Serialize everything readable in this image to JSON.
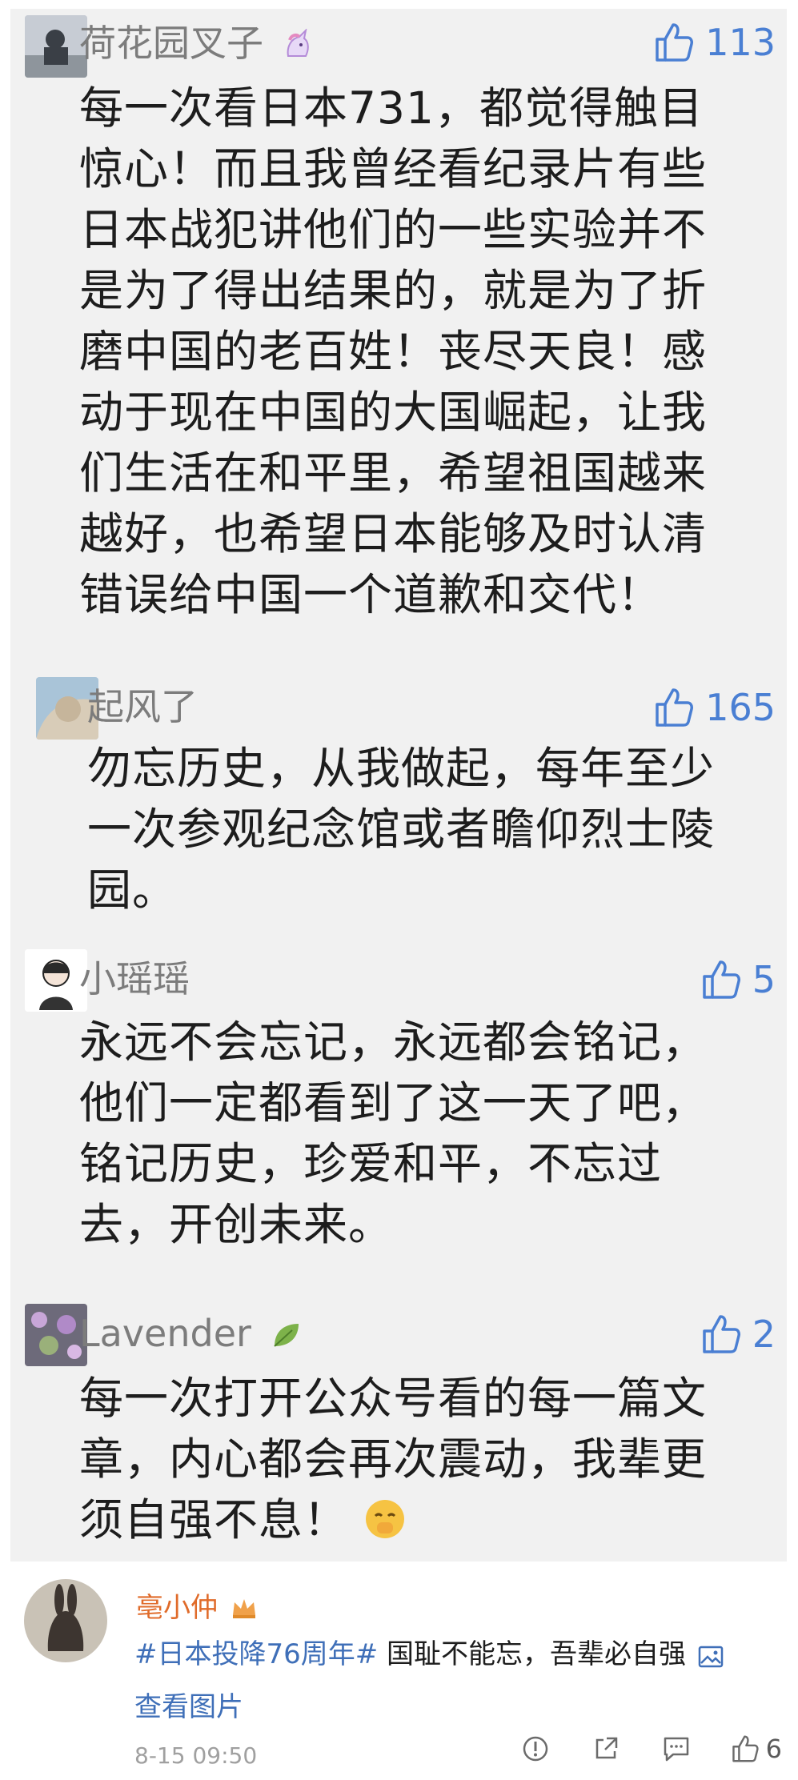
{
  "comments": [
    {
      "name": "荷花园叉子",
      "likes": "113",
      "lines": [
        "每一次看日本731，都觉得触目",
        "惊心！而且我曾经看纪录片有些",
        "日本战犯讲他们的一些实验并不",
        "是为了得出结果的，就是为了折",
        "磨中国的老百姓！丧尽天良！感",
        "动于现在中国的大国崛起，让我",
        "们生活在和平里，希望祖国越来",
        "越好，也希望日本能够及时认清",
        "错误给中国一个道歉和交代！"
      ]
    },
    {
      "name": "起风了",
      "likes": "165",
      "lines": [
        "勿忘历史，从我做起，每年至少",
        "一次参观纪念馆或者瞻仰烈士陵",
        "园。"
      ]
    },
    {
      "name": "小瑶瑶",
      "likes": "5",
      "lines": [
        "永远不会忘记，永远都会铭记，",
        "他们一定都看到了这一天了吧，",
        "铭记历史，珍爱和平，不忘过",
        "去，开创未来。"
      ]
    },
    {
      "name": "Lavender",
      "likes": "2",
      "lines": [
        "每一次打开公众号看的每一篇文",
        "章，内心都会再次震动，我辈更",
        "须自强不息！"
      ]
    }
  ],
  "post": {
    "author": "亳小仲",
    "topic": "#日本投降76周年#",
    "text": " 国耻不能忘，吾辈必自强",
    "view_images": "查看图片",
    "time": "8-15 09:50",
    "likes": "6"
  },
  "colors": {
    "like_blue": "#4a7fd3",
    "topic_blue": "#3f6fb8",
    "author_orange": "#e06b2a"
  }
}
